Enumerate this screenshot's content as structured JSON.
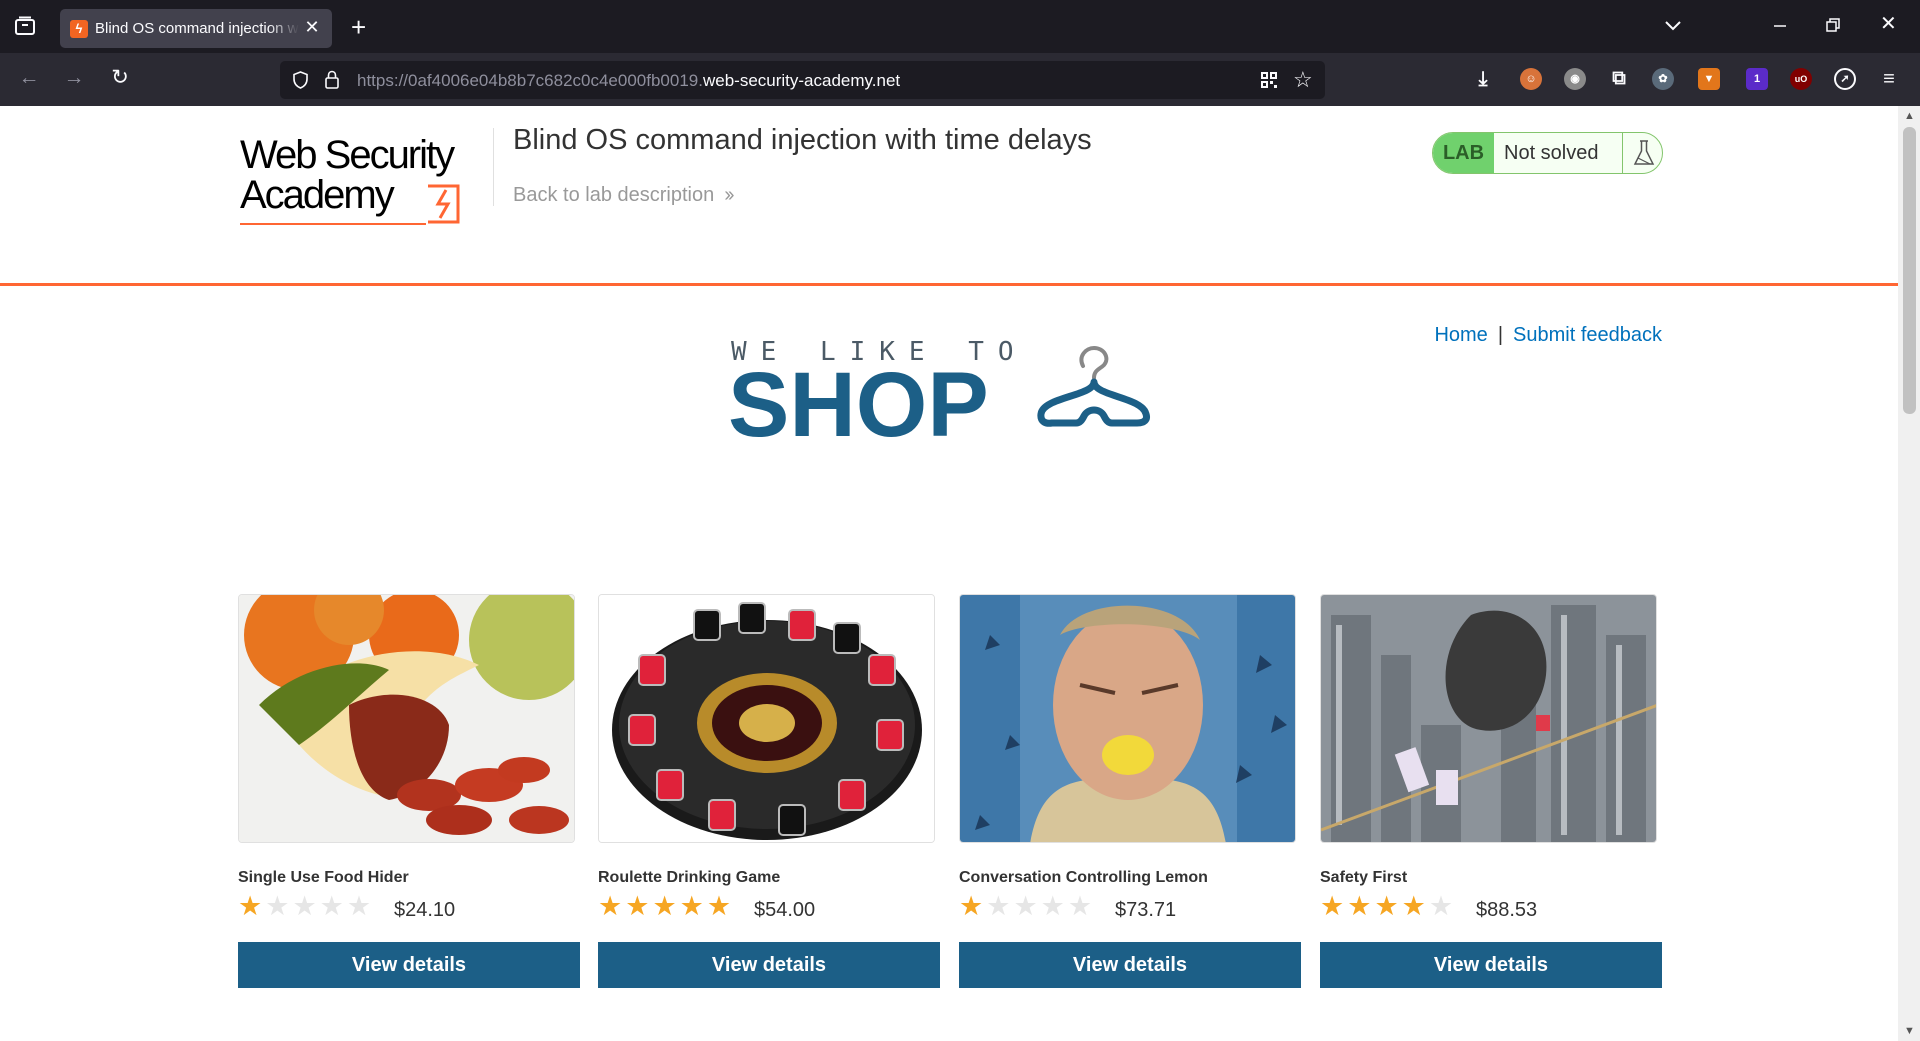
{
  "browser": {
    "tab_title": "Blind OS command injection with time delays",
    "url_prefix": "https://0af4006e04b8b7c682c0c4e000fb0019.",
    "url_host": "web-security-academy.net",
    "ext_badge": "1",
    "ext_ublock_label": "uO"
  },
  "header": {
    "logo_line1": "Web Security",
    "logo_line2": "Academy",
    "lab_title": "Blind OS command injection with time delays",
    "back_link": "Back to lab description",
    "lab_badge": "LAB",
    "lab_status": "Not solved"
  },
  "nav": {
    "home": "Home",
    "separator": "|",
    "feedback": "Submit feedback"
  },
  "banner": {
    "tagline": "WE LIKE TO",
    "title": "SHOP"
  },
  "products": [
    {
      "name": "Single Use Food Hider",
      "rating": 1,
      "price": "$24.10",
      "button": "View details"
    },
    {
      "name": "Roulette Drinking Game",
      "rating": 5,
      "price": "$54.00",
      "button": "View details"
    },
    {
      "name": "Conversation Controlling Lemon",
      "rating": 1,
      "price": "$73.71",
      "button": "View details"
    },
    {
      "name": "Safety First",
      "rating": 4,
      "price": "$88.53",
      "button": "View details"
    }
  ],
  "colors": {
    "accent": "#ff6633",
    "button": "#1c5f87",
    "link": "#0071bc",
    "star": "#f6a623",
    "lab_green": "#70d16d"
  }
}
